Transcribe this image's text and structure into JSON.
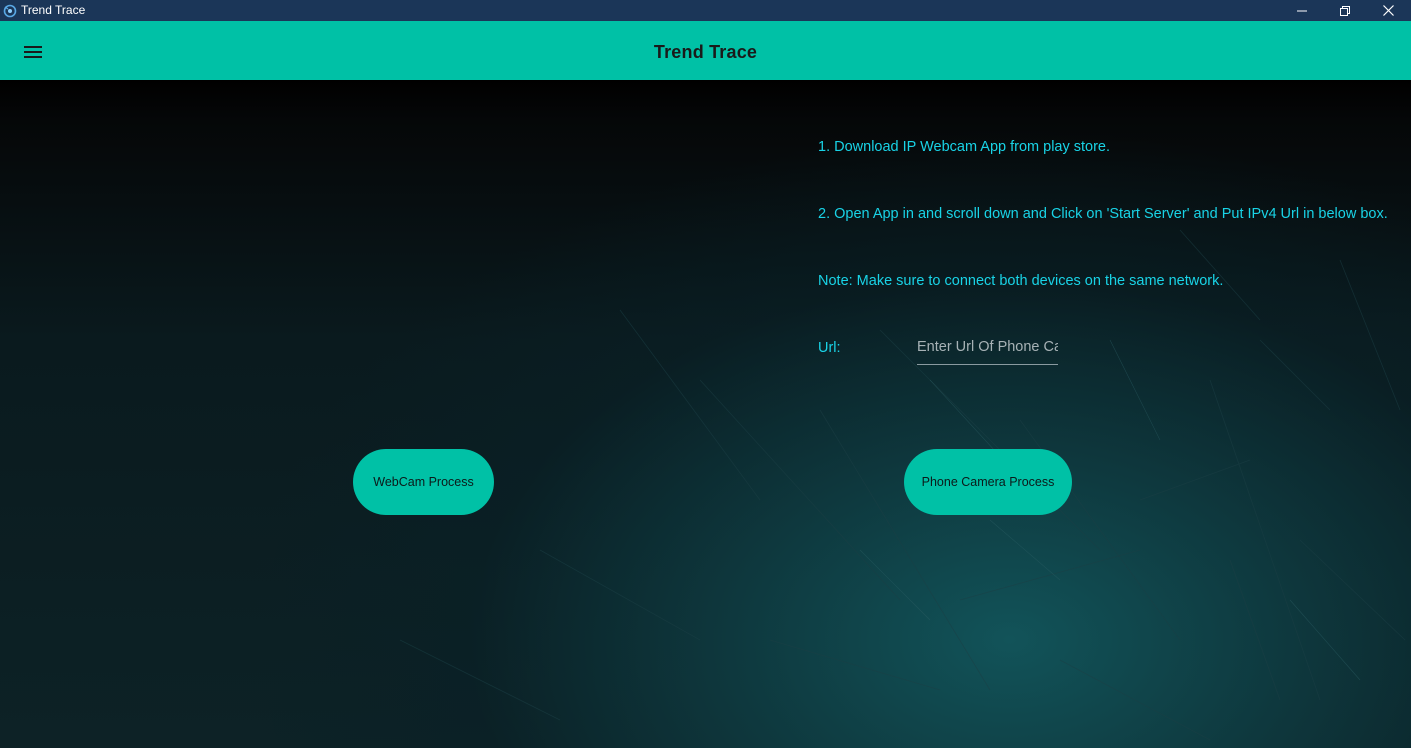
{
  "window": {
    "title": "Trend Trace"
  },
  "icons": {
    "app": "app-logo-icon",
    "minimize": "minimize-icon",
    "restore": "restore-icon",
    "close": "close-icon",
    "menu": "hamburger-menu-icon"
  },
  "appbar": {
    "title": "Trend Trace"
  },
  "instructions": {
    "step1": "1. Download IP Webcam App from play store.",
    "step2": "2. Open App in and scroll down and Click on 'Start Server' and Put IPv4 Url in below box.",
    "note": "Note: Make sure to connect both devices on the same network."
  },
  "url_field": {
    "label": "Url:",
    "placeholder": "Enter Url Of Phone Cam",
    "value": ""
  },
  "buttons": {
    "webcam": "WebCam Process",
    "phone_camera": "Phone Camera Process"
  },
  "colors": {
    "titlebar": "#1b3658",
    "accent": "#00c1a6",
    "instruction_text": "#19d3e6"
  }
}
